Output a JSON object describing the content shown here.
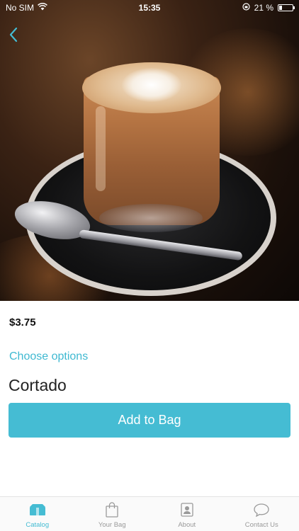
{
  "status_bar": {
    "carrier": "No SIM",
    "time": "15:35",
    "battery": "21 %"
  },
  "product": {
    "price": "$3.75",
    "options_link": "Choose options",
    "name": "Cortado",
    "add_button": "Add to Bag"
  },
  "tab_bar": {
    "tabs": [
      {
        "label": "Catalog",
        "icon": "catalog-icon",
        "active": true
      },
      {
        "label": "Your Bag",
        "icon": "bag-icon",
        "active": false
      },
      {
        "label": "About",
        "icon": "about-icon",
        "active": false
      },
      {
        "label": "Contact Us",
        "icon": "chat-icon",
        "active": false
      }
    ]
  },
  "colors": {
    "accent": "#45bcd3",
    "inactive": "#9a9a9a"
  }
}
